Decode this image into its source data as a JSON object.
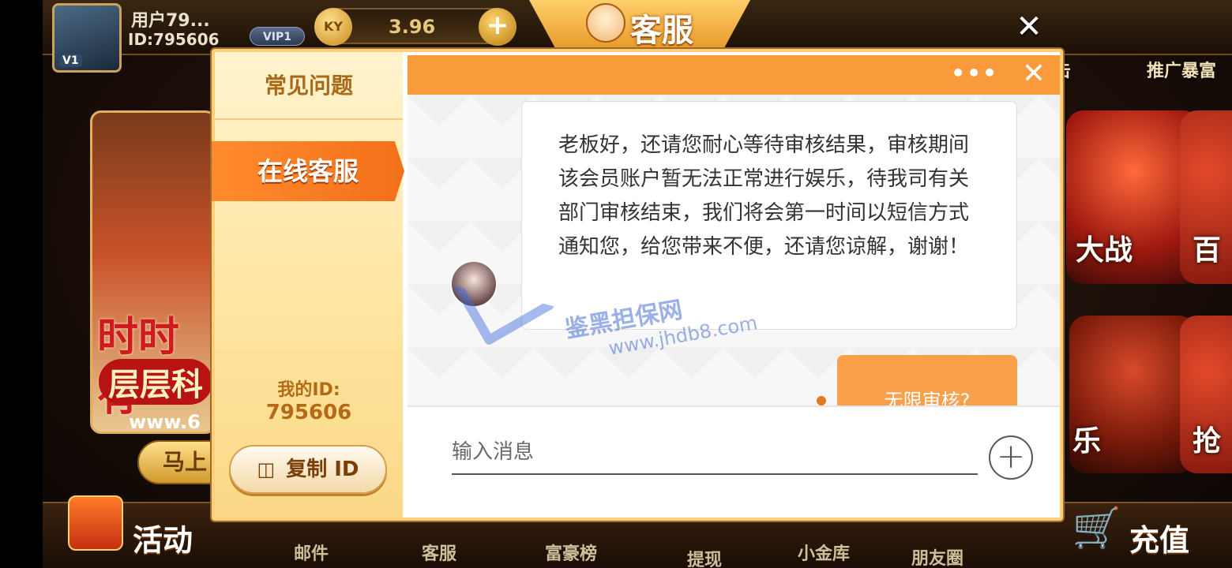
{
  "top_bar": {
    "user_name": "用户79...",
    "user_id": "ID:795606",
    "avatar_level": "V1",
    "vip": "VIP1",
    "coin_symbol": "KY",
    "balance": "3.96",
    "add_label": "+"
  },
  "title": "客服",
  "close_label": "✕",
  "background": {
    "top_labels": [
      "一击",
      "推广暴富"
    ],
    "tile_labels": [
      "大战",
      "百",
      "乐",
      "抢"
    ],
    "promo_line1": "时时有",
    "promo_line2": "层层科",
    "promo_url": "www.6",
    "go_button": "马上",
    "bottom_nav": [
      "活动",
      "邮件",
      "客服",
      "富豪榜",
      "提现",
      "小金库",
      "朋友圈",
      "充值"
    ]
  },
  "sidebar": {
    "faq_tab": "常见问题",
    "online_tab": "在线客服",
    "my_id_label": "我的ID:",
    "my_id_value": "795606",
    "copy_button": "复制 ID",
    "copy_icon": "copy-icon"
  },
  "chat": {
    "header_more": "•••",
    "header_close": "✕",
    "agent_message": "老板好，还请您耐心等待审核结果，审核期间该会员账户暂无法正常进行娱乐，待我司有关部门审核结束，我们将会第一时间以短信方式通知您，给您带来不便，还请您谅解，谢谢！",
    "user_message": "无限审核?",
    "input_placeholder": "输入消息",
    "attach_label": "+"
  },
  "watermark": {
    "text": "鉴黑担保网",
    "url": "www.jhdb8.com"
  },
  "colors": {
    "accent_orange": "#f99a3b",
    "tab_active": "#f3701a",
    "sidebar_text": "#a86a18"
  }
}
